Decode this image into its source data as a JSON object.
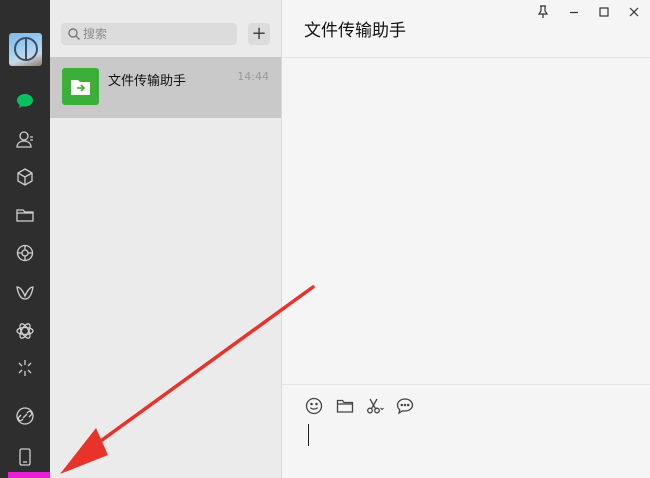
{
  "search": {
    "placeholder": "搜索"
  },
  "add_button": {
    "label": "+"
  },
  "chats": [
    {
      "name": "文件传输助手",
      "time": "14:44"
    }
  ],
  "conversation": {
    "title": "文件传输助手"
  },
  "colors": {
    "rail": "#2e2e2e",
    "chat_active": "#07c160",
    "file_helper": "#3cae3a",
    "arrow": "#e8332a",
    "highlight": "#e81fd6"
  }
}
